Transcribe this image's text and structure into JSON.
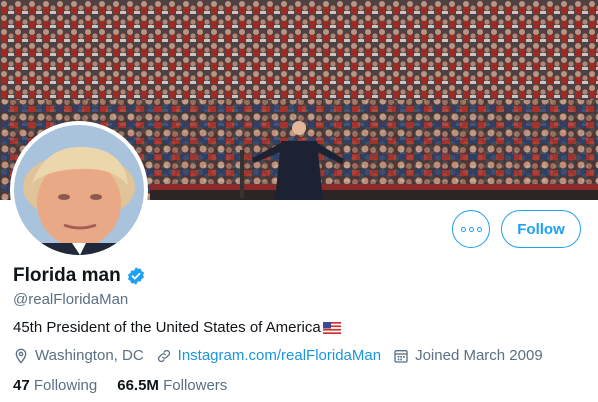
{
  "profile": {
    "display_name": "Florida man",
    "verified": true,
    "handle": "@realFloridaMan",
    "bio": "45th President of the United States of America",
    "bio_emoji": "us-flag-emoji",
    "location": "Washington, DC",
    "website": "Instagram.com/realFloridaMan",
    "joined": "Joined March 2009"
  },
  "stats": {
    "following_count": "47",
    "following_label": "Following",
    "followers_count": "66.5M",
    "followers_label": "Followers"
  },
  "actions": {
    "follow_label": "Follow",
    "more_icon": "more-options-icon"
  },
  "colors": {
    "accent": "#1da1f2",
    "link": "#1b95e0",
    "secondary_text": "#5b7083",
    "primary_text": "#0f1419"
  }
}
